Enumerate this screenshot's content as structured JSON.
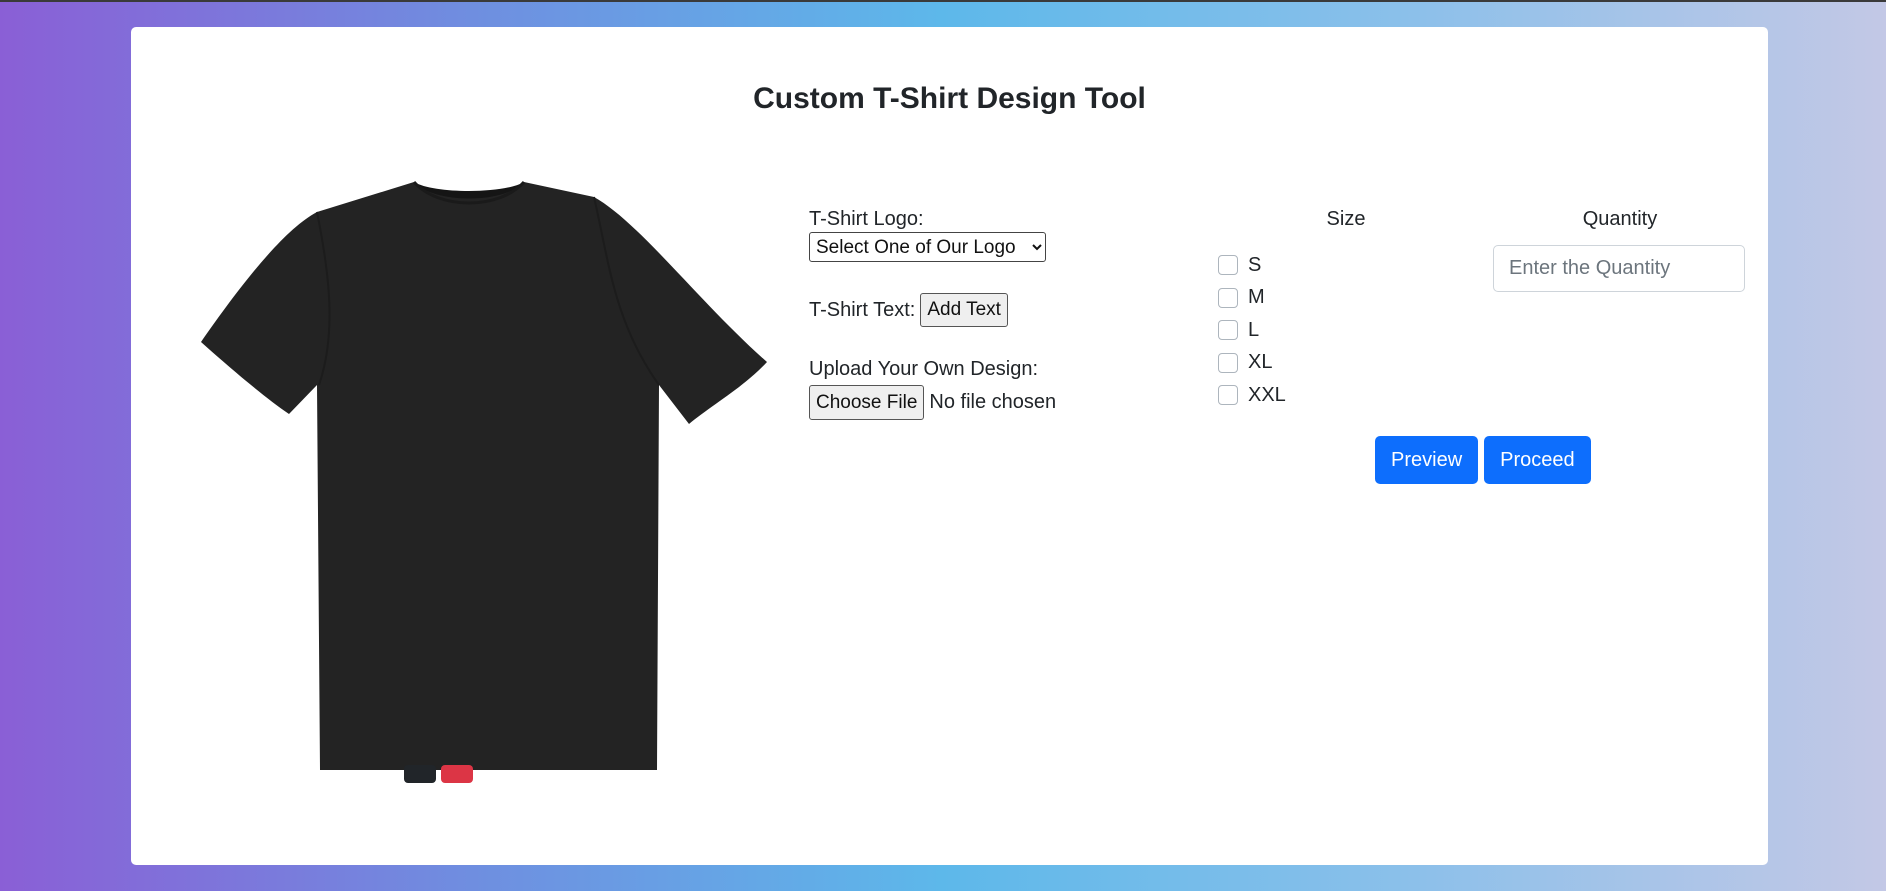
{
  "page": {
    "title": "Custom T-Shirt Design Tool"
  },
  "colors": {
    "accent": "#0d6efd",
    "shirt": "#232323",
    "background_gradient": [
      "#8a5fd6",
      "#5db8ea",
      "#c3c8e6"
    ]
  },
  "preview": {
    "image": "t-shirt-front-black",
    "swatches": [
      {
        "name": "dark",
        "color": "#212529"
      },
      {
        "name": "red",
        "color": "#dc3545"
      }
    ]
  },
  "form": {
    "logo_label": "T-Shirt Logo:",
    "logo_select_value": "Select One of Our Logo",
    "text_label": "T-Shirt Text:",
    "add_text_button": "Add Text",
    "upload_label": "Upload Your Own Design:",
    "choose_file_button": "Choose File",
    "file_status": "No file chosen"
  },
  "size": {
    "heading": "Size",
    "options": [
      {
        "label": "S",
        "checked": false
      },
      {
        "label": "M",
        "checked": false
      },
      {
        "label": "L",
        "checked": false
      },
      {
        "label": "XL",
        "checked": false
      },
      {
        "label": "XXL",
        "checked": false
      }
    ]
  },
  "quantity": {
    "heading": "Quantity",
    "placeholder": "Enter the Quantity",
    "value": ""
  },
  "actions": {
    "preview_label": "Preview",
    "proceed_label": "Proceed"
  }
}
